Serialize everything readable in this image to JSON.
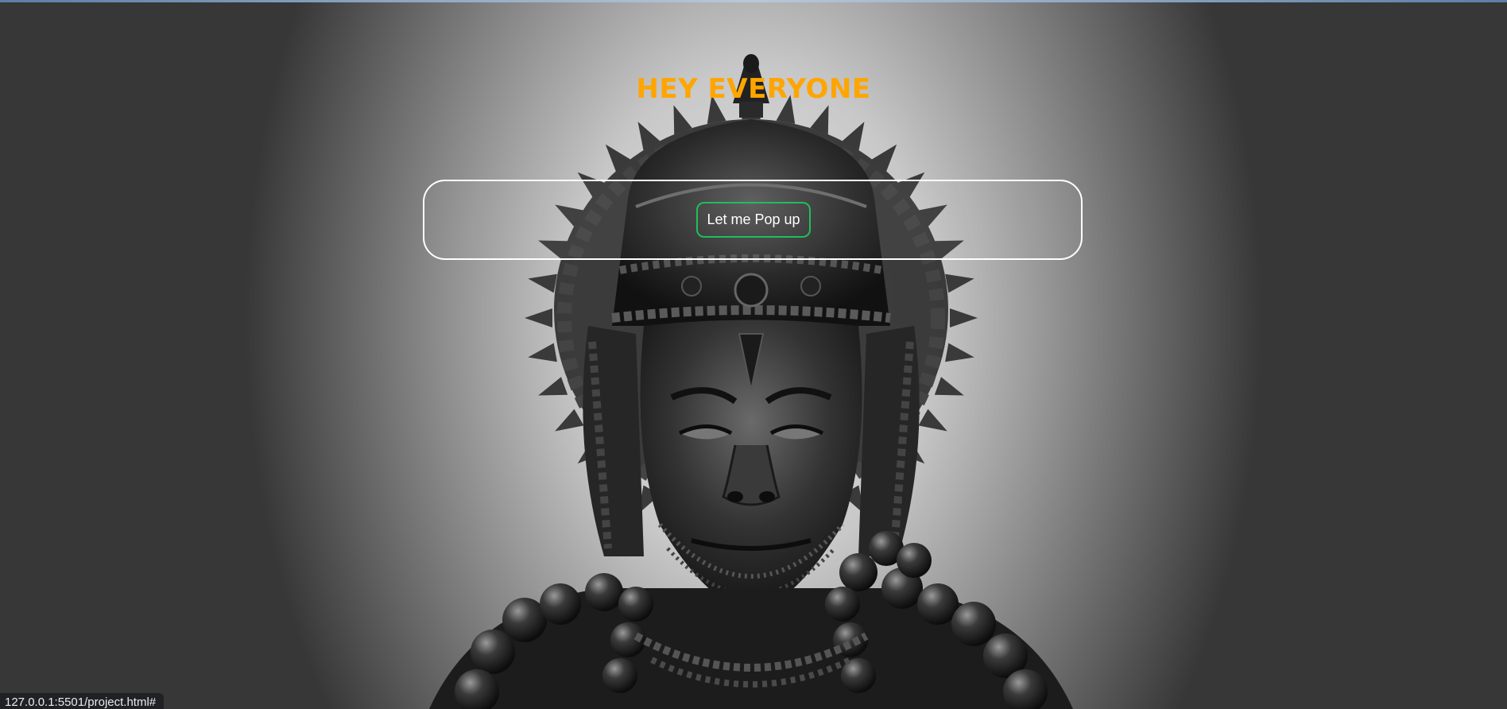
{
  "page": {
    "heading": "HEY EVERYONE",
    "accent_color": "#ffa500"
  },
  "popup_panel": {
    "button_label": "Let me Pop up",
    "button_border_color": "#1fbf5a"
  },
  "background": {
    "image": "statue-photo"
  },
  "status_bar": {
    "url": "127.0.0.1:5501/project.html#"
  }
}
